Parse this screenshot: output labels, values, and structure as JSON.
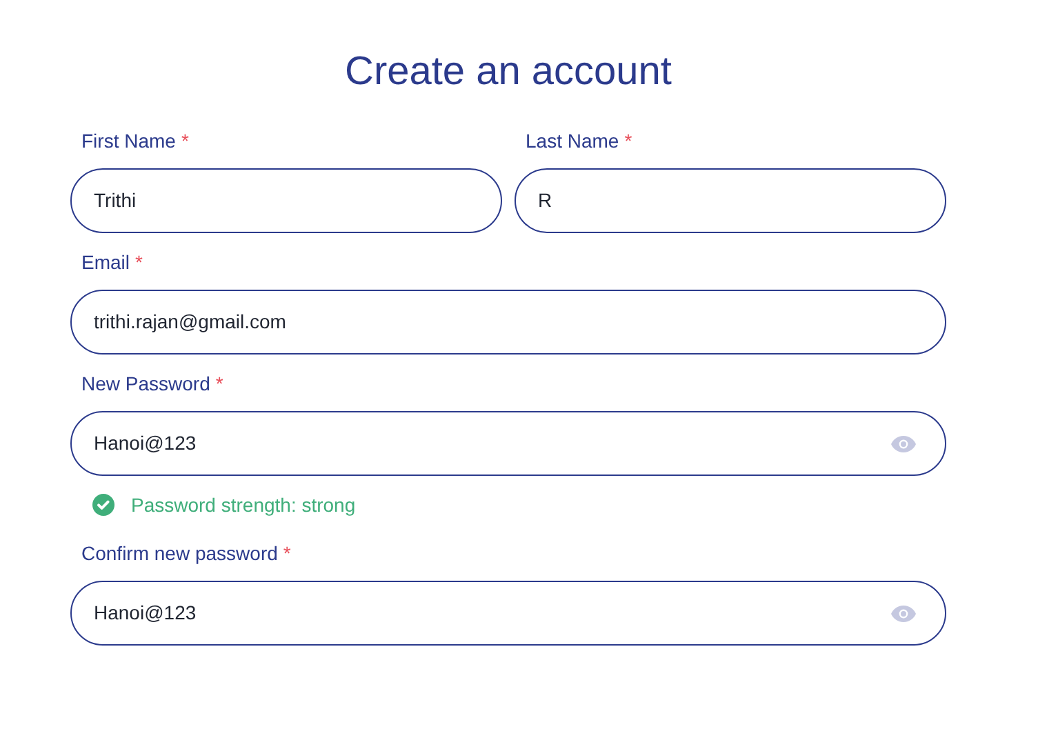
{
  "title": "Create an account",
  "rows": [
    {
      "fields": [
        {
          "label": "First Name",
          "required_mark": "*",
          "value": "Trithi",
          "kind": "text"
        },
        {
          "label": "Last Name",
          "required_mark": "*",
          "value": "R",
          "kind": "text"
        }
      ]
    },
    {
      "fields": [
        {
          "label": "Email",
          "required_mark": "*",
          "value": "trithi.rajan@gmail.com",
          "kind": "text"
        }
      ]
    },
    {
      "fields": [
        {
          "label": "New Password",
          "required_mark": "*",
          "value": "Hanoi@123",
          "kind": "password"
        }
      ],
      "strength": {
        "text": "Password strength: strong",
        "passed": true
      }
    },
    {
      "fields": [
        {
          "label": "Confirm new password",
          "required_mark": "*",
          "value": "Hanoi@123",
          "kind": "password"
        }
      ]
    }
  ]
}
